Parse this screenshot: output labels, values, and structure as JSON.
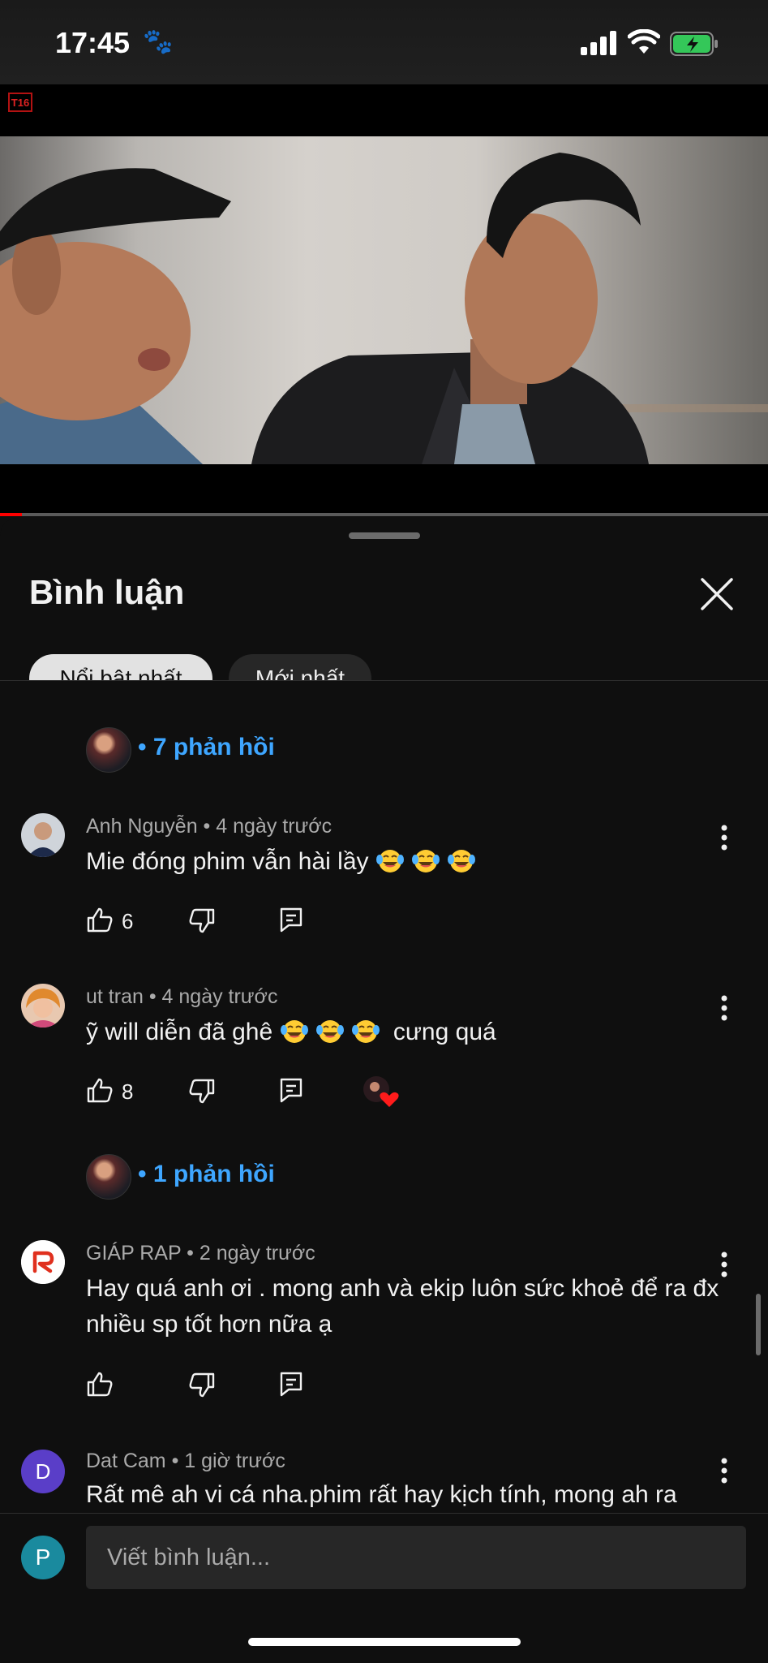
{
  "status_bar": {
    "time": "17:45"
  },
  "video": {
    "rating_badge": "T16",
    "progress_fraction": 0.028
  },
  "comments_sheet": {
    "title": "Bình luận",
    "filters": [
      "Nổi bật nhất",
      "Mới nhất"
    ],
    "replies_1": "• 7 phản hồi",
    "replies_2": "• 1 phản hồi",
    "comments": [
      {
        "author": "Anh Nguyễn",
        "time": "4 ngày trước",
        "text": "Mie đóng phim vẫn hài lầy",
        "emoji_count": 3,
        "likes": "6"
      },
      {
        "author": "ut tran",
        "time": "4 ngày trước",
        "text_before": "ỹ will diễn đã ghê",
        "text_after": "cưng quá",
        "emoji_count": 3,
        "likes": "8"
      },
      {
        "author": "GIÁP RAP",
        "time": "2 ngày trước",
        "text": "Hay quá anh ơi . mong anh và ekip luôn sức khoẻ để ra đx nhiều sp tốt hơn nữa ạ",
        "likes": ""
      },
      {
        "author": "Dat Cam",
        "time": "1 giờ trước",
        "avatar_letter": "D",
        "text": "Rất mê ah vi cá nha.phim rất hay kịch tính, mong ah ra"
      }
    ],
    "input": {
      "placeholder": "Viết bình luận...",
      "user_letter": "P"
    }
  },
  "colors": {
    "accent_link": "#3ea6ff",
    "progress": "#ff0000",
    "background": "#0f0f0f"
  }
}
